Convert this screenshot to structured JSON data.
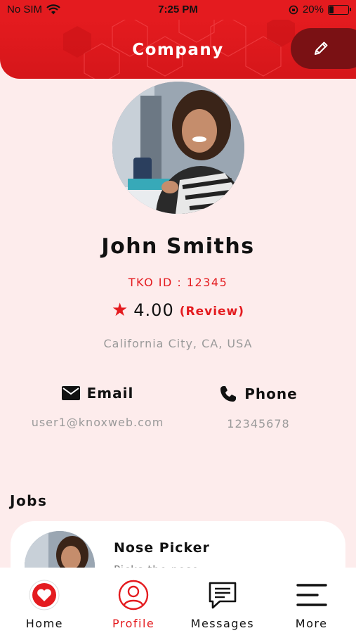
{
  "status_bar": {
    "carrier": "No SIM",
    "time": "7:25 PM",
    "battery_text": "20%",
    "battery_level": 0.2
  },
  "header": {
    "title": "Company",
    "edit_icon": "pencil-icon"
  },
  "profile": {
    "name": "John Smiths",
    "tko_id": "TKO ID : 12345",
    "rating": "4.00",
    "review_label": "(Review)",
    "location": "California City, CA, USA"
  },
  "contacts": {
    "email": {
      "label": "Email",
      "value": "user1@knoxweb.com",
      "icon": "envelope-icon"
    },
    "phone": {
      "label": "Phone",
      "value": "12345678",
      "icon": "phone-icon"
    }
  },
  "jobs": {
    "title": "Jobs",
    "items": [
      {
        "title": "Nose Picker",
        "description": "Picks the nose"
      }
    ]
  },
  "bottom_nav": {
    "items": [
      {
        "label": "Home",
        "icon": "heart-icon"
      },
      {
        "label": "Profile",
        "icon": "user-icon",
        "active": true
      },
      {
        "label": "Messages",
        "icon": "chat-icon"
      },
      {
        "label": "More",
        "icon": "menu-icon"
      }
    ]
  },
  "colors": {
    "accent": "#e41b1f",
    "header_dark": "#7a1114",
    "background": "#fdecec",
    "muted_text": "#9a9a9a"
  }
}
